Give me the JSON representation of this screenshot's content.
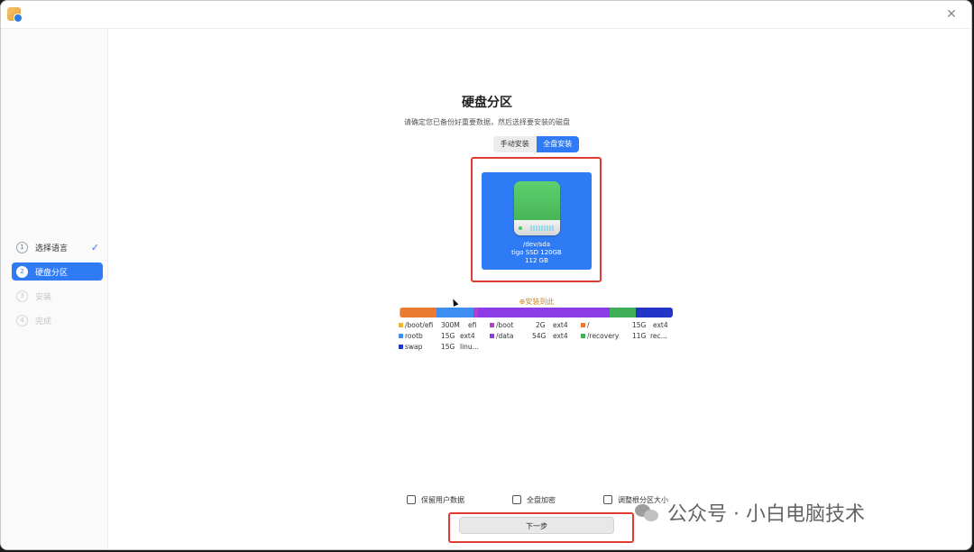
{
  "window": {
    "close_symbol": "✕"
  },
  "sidebar": {
    "steps": [
      {
        "num": "1",
        "label": "选择语言",
        "state": "done",
        "check": "✓"
      },
      {
        "num": "2",
        "label": "硬盘分区",
        "state": "active"
      },
      {
        "num": "3",
        "label": "安装",
        "state": "disabled"
      },
      {
        "num": "4",
        "label": "完成",
        "state": "disabled"
      }
    ]
  },
  "main": {
    "title": "硬盘分区",
    "subtitle": "请确定您已备份好重要数据，然后选择要安装的磁盘",
    "mode_toggle": {
      "manual": "手动安装",
      "full": "全盘安装",
      "selected": "full"
    },
    "disk": {
      "device": "/dev/sda",
      "model_size": "tigo SSD  120GB",
      "capacity": "112 GB",
      "icon": "hard-drive-icon",
      "selected": true
    },
    "install_here": "⊕安装到此",
    "partitions": [
      {
        "name": "/boot/efi",
        "size": "300M",
        "fs": "efi",
        "color": "#f0b43a",
        "share": 0.3
      },
      {
        "name": "/boot",
        "size": "2G",
        "fs": "ext4",
        "color": "#b43fc9",
        "share": 2
      },
      {
        "name": "/",
        "size": "15G",
        "fs": "ext4",
        "color": "#ea7a30",
        "share": 15
      },
      {
        "name": "rootb",
        "size": "15G",
        "fs": "ext4",
        "color": "#3d8ef0",
        "share": 15
      },
      {
        "name": "/data",
        "size": "54G",
        "fs": "ext4",
        "color": "#8d3be6",
        "share": 54
      },
      {
        "name": "/recovery",
        "size": "11G",
        "fs": "rec...",
        "color": "#3fae56",
        "share": 11
      },
      {
        "name": "swap",
        "size": "15G",
        "fs": "linu...",
        "color": "#2334c9",
        "share": 15
      }
    ],
    "options": {
      "keep_user_data": "保留用户数据",
      "full_disk_encryption": "全盘加密",
      "adjust_partition": "调整根分区大小"
    },
    "next_button": "下一步"
  },
  "watermark": {
    "text": "公众号 · 小白电脑技术"
  },
  "colors": {
    "accent": "#2f7bf5",
    "highlight": "#e03b30",
    "install_here": "#d1861b"
  }
}
